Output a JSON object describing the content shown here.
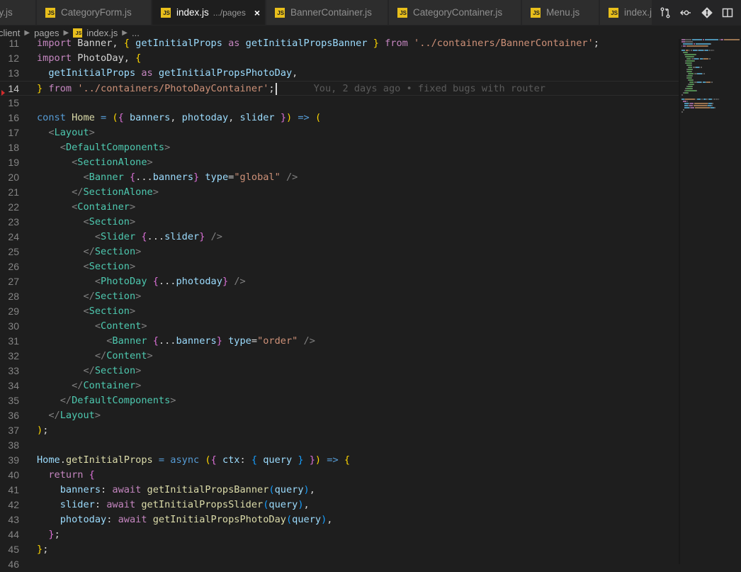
{
  "tabs": [
    {
      "label": "ry.js",
      "description": "",
      "active": false
    },
    {
      "label": "CategoryForm.js",
      "description": "",
      "active": false
    },
    {
      "label": "index.js",
      "description": ".../pages",
      "active": true
    },
    {
      "label": "BannerContainer.js",
      "description": "",
      "active": false
    },
    {
      "label": "CategoryContainer.js",
      "description": "",
      "active": false
    },
    {
      "label": "Menu.js",
      "description": "",
      "active": false
    },
    {
      "label": "index.js",
      "description": "",
      "active": false
    }
  ],
  "file_icon_text": "JS",
  "close_glyph": "×",
  "editor_actions": [
    "compare-changes-icon",
    "open-changes-icon",
    "git-icon",
    "split-editor-icon"
  ],
  "breadcrumb": [
    "client",
    "pages",
    "index.js",
    "..."
  ],
  "editor": {
    "active_line": 14,
    "blame": "You, 2 days ago • fixed bugs with router",
    "lines": [
      {
        "n": "11",
        "tokens": [
          [
            "kw",
            "import"
          ],
          [
            "def",
            " Banner, "
          ],
          [
            "br1",
            "{"
          ],
          [
            "def",
            " "
          ],
          [
            "var",
            "getInitialProps"
          ],
          [
            "def",
            " "
          ],
          [
            "kw",
            "as"
          ],
          [
            "def",
            " "
          ],
          [
            "var",
            "getInitialPropsBanner"
          ],
          [
            "def",
            " "
          ],
          [
            "br1",
            "}"
          ],
          [
            "def",
            " "
          ],
          [
            "kw",
            "from"
          ],
          [
            "def",
            " "
          ],
          [
            "str",
            "'../containers/BannerContainer'"
          ],
          [
            "def",
            ";"
          ]
        ]
      },
      {
        "n": "12",
        "tokens": [
          [
            "kw",
            "import"
          ],
          [
            "def",
            " PhotoDay, "
          ],
          [
            "br1",
            "{"
          ]
        ]
      },
      {
        "n": "13",
        "tokens": [
          [
            "def",
            "  "
          ],
          [
            "var",
            "getInitialProps"
          ],
          [
            "def",
            " "
          ],
          [
            "kw",
            "as"
          ],
          [
            "def",
            " "
          ],
          [
            "var",
            "getInitialPropsPhotoDay"
          ],
          [
            "def",
            ","
          ]
        ]
      },
      {
        "n": "14",
        "tokens": [
          [
            "br1",
            "}"
          ],
          [
            "def",
            " "
          ],
          [
            "kw",
            "from"
          ],
          [
            "def",
            " "
          ],
          [
            "str",
            "'../containers/PhotoDayContainer'"
          ],
          [
            "def",
            ";"
          ]
        ]
      },
      {
        "n": "15",
        "tokens": []
      },
      {
        "n": "16",
        "tokens": [
          [
            "key",
            "const"
          ],
          [
            "def",
            " "
          ],
          [
            "fn",
            "Home"
          ],
          [
            "def",
            " "
          ],
          [
            "op",
            "="
          ],
          [
            "def",
            " "
          ],
          [
            "br1",
            "("
          ],
          [
            "br2",
            "{"
          ],
          [
            "def",
            " "
          ],
          [
            "var",
            "banners"
          ],
          [
            "def",
            ", "
          ],
          [
            "var",
            "photoday"
          ],
          [
            "def",
            ", "
          ],
          [
            "var",
            "slider"
          ],
          [
            "def",
            " "
          ],
          [
            "br2",
            "}"
          ],
          [
            "br1",
            ")"
          ],
          [
            "def",
            " "
          ],
          [
            "op",
            "=>"
          ],
          [
            "def",
            " "
          ],
          [
            "br1",
            "("
          ]
        ]
      },
      {
        "n": "17",
        "tokens": [
          [
            "def",
            "  "
          ],
          [
            "punc",
            "<"
          ],
          [
            "tag",
            "Layout"
          ],
          [
            "punc",
            ">"
          ]
        ]
      },
      {
        "n": "18",
        "tokens": [
          [
            "def",
            "    "
          ],
          [
            "punc",
            "<"
          ],
          [
            "tag",
            "DefaultComponents"
          ],
          [
            "punc",
            ">"
          ]
        ]
      },
      {
        "n": "19",
        "tokens": [
          [
            "def",
            "      "
          ],
          [
            "punc",
            "<"
          ],
          [
            "tag",
            "SectionAlone"
          ],
          [
            "punc",
            ">"
          ]
        ]
      },
      {
        "n": "20",
        "tokens": [
          [
            "def",
            "        "
          ],
          [
            "punc",
            "<"
          ],
          [
            "tag",
            "Banner"
          ],
          [
            "def",
            " "
          ],
          [
            "br2",
            "{"
          ],
          [
            "def",
            "..."
          ],
          [
            "var",
            "banners"
          ],
          [
            "br2",
            "}"
          ],
          [
            "def",
            " "
          ],
          [
            "var",
            "type"
          ],
          [
            "def",
            "="
          ],
          [
            "str",
            "\"global\""
          ],
          [
            "def",
            " "
          ],
          [
            "punc",
            "/>"
          ]
        ]
      },
      {
        "n": "21",
        "tokens": [
          [
            "def",
            "      "
          ],
          [
            "punc",
            "</"
          ],
          [
            "tag",
            "SectionAlone"
          ],
          [
            "punc",
            ">"
          ]
        ]
      },
      {
        "n": "22",
        "tokens": [
          [
            "def",
            "      "
          ],
          [
            "punc",
            "<"
          ],
          [
            "tag",
            "Container"
          ],
          [
            "punc",
            ">"
          ]
        ]
      },
      {
        "n": "23",
        "tokens": [
          [
            "def",
            "        "
          ],
          [
            "punc",
            "<"
          ],
          [
            "tag",
            "Section"
          ],
          [
            "punc",
            ">"
          ]
        ]
      },
      {
        "n": "24",
        "tokens": [
          [
            "def",
            "          "
          ],
          [
            "punc",
            "<"
          ],
          [
            "tag",
            "Slider"
          ],
          [
            "def",
            " "
          ],
          [
            "br2",
            "{"
          ],
          [
            "def",
            "..."
          ],
          [
            "var",
            "slider"
          ],
          [
            "br2",
            "}"
          ],
          [
            "def",
            " "
          ],
          [
            "punc",
            "/>"
          ]
        ]
      },
      {
        "n": "25",
        "tokens": [
          [
            "def",
            "        "
          ],
          [
            "punc",
            "</"
          ],
          [
            "tag",
            "Section"
          ],
          [
            "punc",
            ">"
          ]
        ]
      },
      {
        "n": "26",
        "tokens": [
          [
            "def",
            "        "
          ],
          [
            "punc",
            "<"
          ],
          [
            "tag",
            "Section"
          ],
          [
            "punc",
            ">"
          ]
        ]
      },
      {
        "n": "27",
        "tokens": [
          [
            "def",
            "          "
          ],
          [
            "punc",
            "<"
          ],
          [
            "tag",
            "PhotoDay"
          ],
          [
            "def",
            " "
          ],
          [
            "br2",
            "{"
          ],
          [
            "def",
            "..."
          ],
          [
            "var",
            "photoday"
          ],
          [
            "br2",
            "}"
          ],
          [
            "def",
            " "
          ],
          [
            "punc",
            "/>"
          ]
        ]
      },
      {
        "n": "28",
        "tokens": [
          [
            "def",
            "        "
          ],
          [
            "punc",
            "</"
          ],
          [
            "tag",
            "Section"
          ],
          [
            "punc",
            ">"
          ]
        ]
      },
      {
        "n": "29",
        "tokens": [
          [
            "def",
            "        "
          ],
          [
            "punc",
            "<"
          ],
          [
            "tag",
            "Section"
          ],
          [
            "punc",
            ">"
          ]
        ]
      },
      {
        "n": "30",
        "tokens": [
          [
            "def",
            "          "
          ],
          [
            "punc",
            "<"
          ],
          [
            "tag",
            "Content"
          ],
          [
            "punc",
            ">"
          ]
        ]
      },
      {
        "n": "31",
        "tokens": [
          [
            "def",
            "            "
          ],
          [
            "punc",
            "<"
          ],
          [
            "tag",
            "Banner"
          ],
          [
            "def",
            " "
          ],
          [
            "br2",
            "{"
          ],
          [
            "def",
            "..."
          ],
          [
            "var",
            "banners"
          ],
          [
            "br2",
            "}"
          ],
          [
            "def",
            " "
          ],
          [
            "var",
            "type"
          ],
          [
            "def",
            "="
          ],
          [
            "str",
            "\"order\""
          ],
          [
            "def",
            " "
          ],
          [
            "punc",
            "/>"
          ]
        ]
      },
      {
        "n": "32",
        "tokens": [
          [
            "def",
            "          "
          ],
          [
            "punc",
            "</"
          ],
          [
            "tag",
            "Content"
          ],
          [
            "punc",
            ">"
          ]
        ]
      },
      {
        "n": "33",
        "tokens": [
          [
            "def",
            "        "
          ],
          [
            "punc",
            "</"
          ],
          [
            "tag",
            "Section"
          ],
          [
            "punc",
            ">"
          ]
        ]
      },
      {
        "n": "34",
        "tokens": [
          [
            "def",
            "      "
          ],
          [
            "punc",
            "</"
          ],
          [
            "tag",
            "Container"
          ],
          [
            "punc",
            ">"
          ]
        ]
      },
      {
        "n": "35",
        "tokens": [
          [
            "def",
            "    "
          ],
          [
            "punc",
            "</"
          ],
          [
            "tag",
            "DefaultComponents"
          ],
          [
            "punc",
            ">"
          ]
        ]
      },
      {
        "n": "36",
        "tokens": [
          [
            "def",
            "  "
          ],
          [
            "punc",
            "</"
          ],
          [
            "tag",
            "Layout"
          ],
          [
            "punc",
            ">"
          ]
        ]
      },
      {
        "n": "37",
        "tokens": [
          [
            "br1",
            ")"
          ],
          [
            "def",
            ";"
          ]
        ]
      },
      {
        "n": "38",
        "tokens": []
      },
      {
        "n": "39",
        "tokens": [
          [
            "var",
            "Home"
          ],
          [
            "def",
            "."
          ],
          [
            "fn",
            "getInitialProps"
          ],
          [
            "def",
            " "
          ],
          [
            "op",
            "="
          ],
          [
            "def",
            " "
          ],
          [
            "key",
            "async"
          ],
          [
            "def",
            " "
          ],
          [
            "br1",
            "("
          ],
          [
            "br2",
            "{"
          ],
          [
            "def",
            " "
          ],
          [
            "var",
            "ctx"
          ],
          [
            "def",
            ": "
          ],
          [
            "br3",
            "{"
          ],
          [
            "def",
            " "
          ],
          [
            "var",
            "query"
          ],
          [
            "def",
            " "
          ],
          [
            "br3",
            "}"
          ],
          [
            "def",
            " "
          ],
          [
            "br2",
            "}"
          ],
          [
            "br1",
            ")"
          ],
          [
            "def",
            " "
          ],
          [
            "op",
            "=>"
          ],
          [
            "def",
            " "
          ],
          [
            "br1",
            "{"
          ]
        ]
      },
      {
        "n": "40",
        "tokens": [
          [
            "def",
            "  "
          ],
          [
            "kw",
            "return"
          ],
          [
            "def",
            " "
          ],
          [
            "br2",
            "{"
          ]
        ]
      },
      {
        "n": "41",
        "tokens": [
          [
            "def",
            "    "
          ],
          [
            "var",
            "banners"
          ],
          [
            "def",
            ": "
          ],
          [
            "kw",
            "await"
          ],
          [
            "def",
            " "
          ],
          [
            "fn",
            "getInitialPropsBanner"
          ],
          [
            "br3",
            "("
          ],
          [
            "var",
            "query"
          ],
          [
            "br3",
            ")"
          ],
          [
            "def",
            ","
          ]
        ]
      },
      {
        "n": "42",
        "tokens": [
          [
            "def",
            "    "
          ],
          [
            "var",
            "slider"
          ],
          [
            "def",
            ": "
          ],
          [
            "kw",
            "await"
          ],
          [
            "def",
            " "
          ],
          [
            "fn",
            "getInitialPropsSlider"
          ],
          [
            "br3",
            "("
          ],
          [
            "var",
            "query"
          ],
          [
            "br3",
            ")"
          ],
          [
            "def",
            ","
          ]
        ]
      },
      {
        "n": "43",
        "tokens": [
          [
            "def",
            "    "
          ],
          [
            "var",
            "photoday"
          ],
          [
            "def",
            ": "
          ],
          [
            "kw",
            "await"
          ],
          [
            "def",
            " "
          ],
          [
            "fn",
            "getInitialPropsPhotoDay"
          ],
          [
            "br3",
            "("
          ],
          [
            "var",
            "query"
          ],
          [
            "br3",
            ")"
          ],
          [
            "def",
            ","
          ]
        ]
      },
      {
        "n": "44",
        "tokens": [
          [
            "def",
            "  "
          ],
          [
            "br2",
            "}"
          ],
          [
            "def",
            ";"
          ]
        ]
      },
      {
        "n": "45",
        "tokens": [
          [
            "br1",
            "}"
          ],
          [
            "def",
            ";"
          ]
        ]
      },
      {
        "n": "46",
        "tokens": []
      }
    ]
  }
}
